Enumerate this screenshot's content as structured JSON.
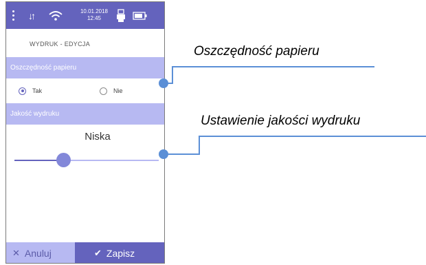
{
  "statusbar": {
    "menu_icon": "dots-vertical-icon",
    "sync_icon": "up-down-arrows-icon",
    "wifi_icon": "wifi-icon",
    "date": "10.01.2018",
    "time": "12:45",
    "printer_icon": "printer-icon",
    "battery_icon": "battery-icon"
  },
  "screen": {
    "title": "WYDRUK - EDYCJA",
    "paper_saving": {
      "header": "Oszczędność papieru",
      "options": [
        {
          "label": "Tak",
          "selected": true
        },
        {
          "label": "Nie",
          "selected": false
        }
      ]
    },
    "print_quality": {
      "header": "Jakość wydruku",
      "value": "Niska",
      "slider_level": 0.32
    }
  },
  "buttons": {
    "cancel_label": "Anuluj",
    "save_label": "Zapisz"
  },
  "callouts": {
    "paper_saving": "Oszczędność papieru",
    "print_quality": "Ustawienie jakości wydruku"
  },
  "colors": {
    "primary": "#6463bd",
    "light": "#b7b9f2",
    "callout": "#5b8fd6"
  }
}
